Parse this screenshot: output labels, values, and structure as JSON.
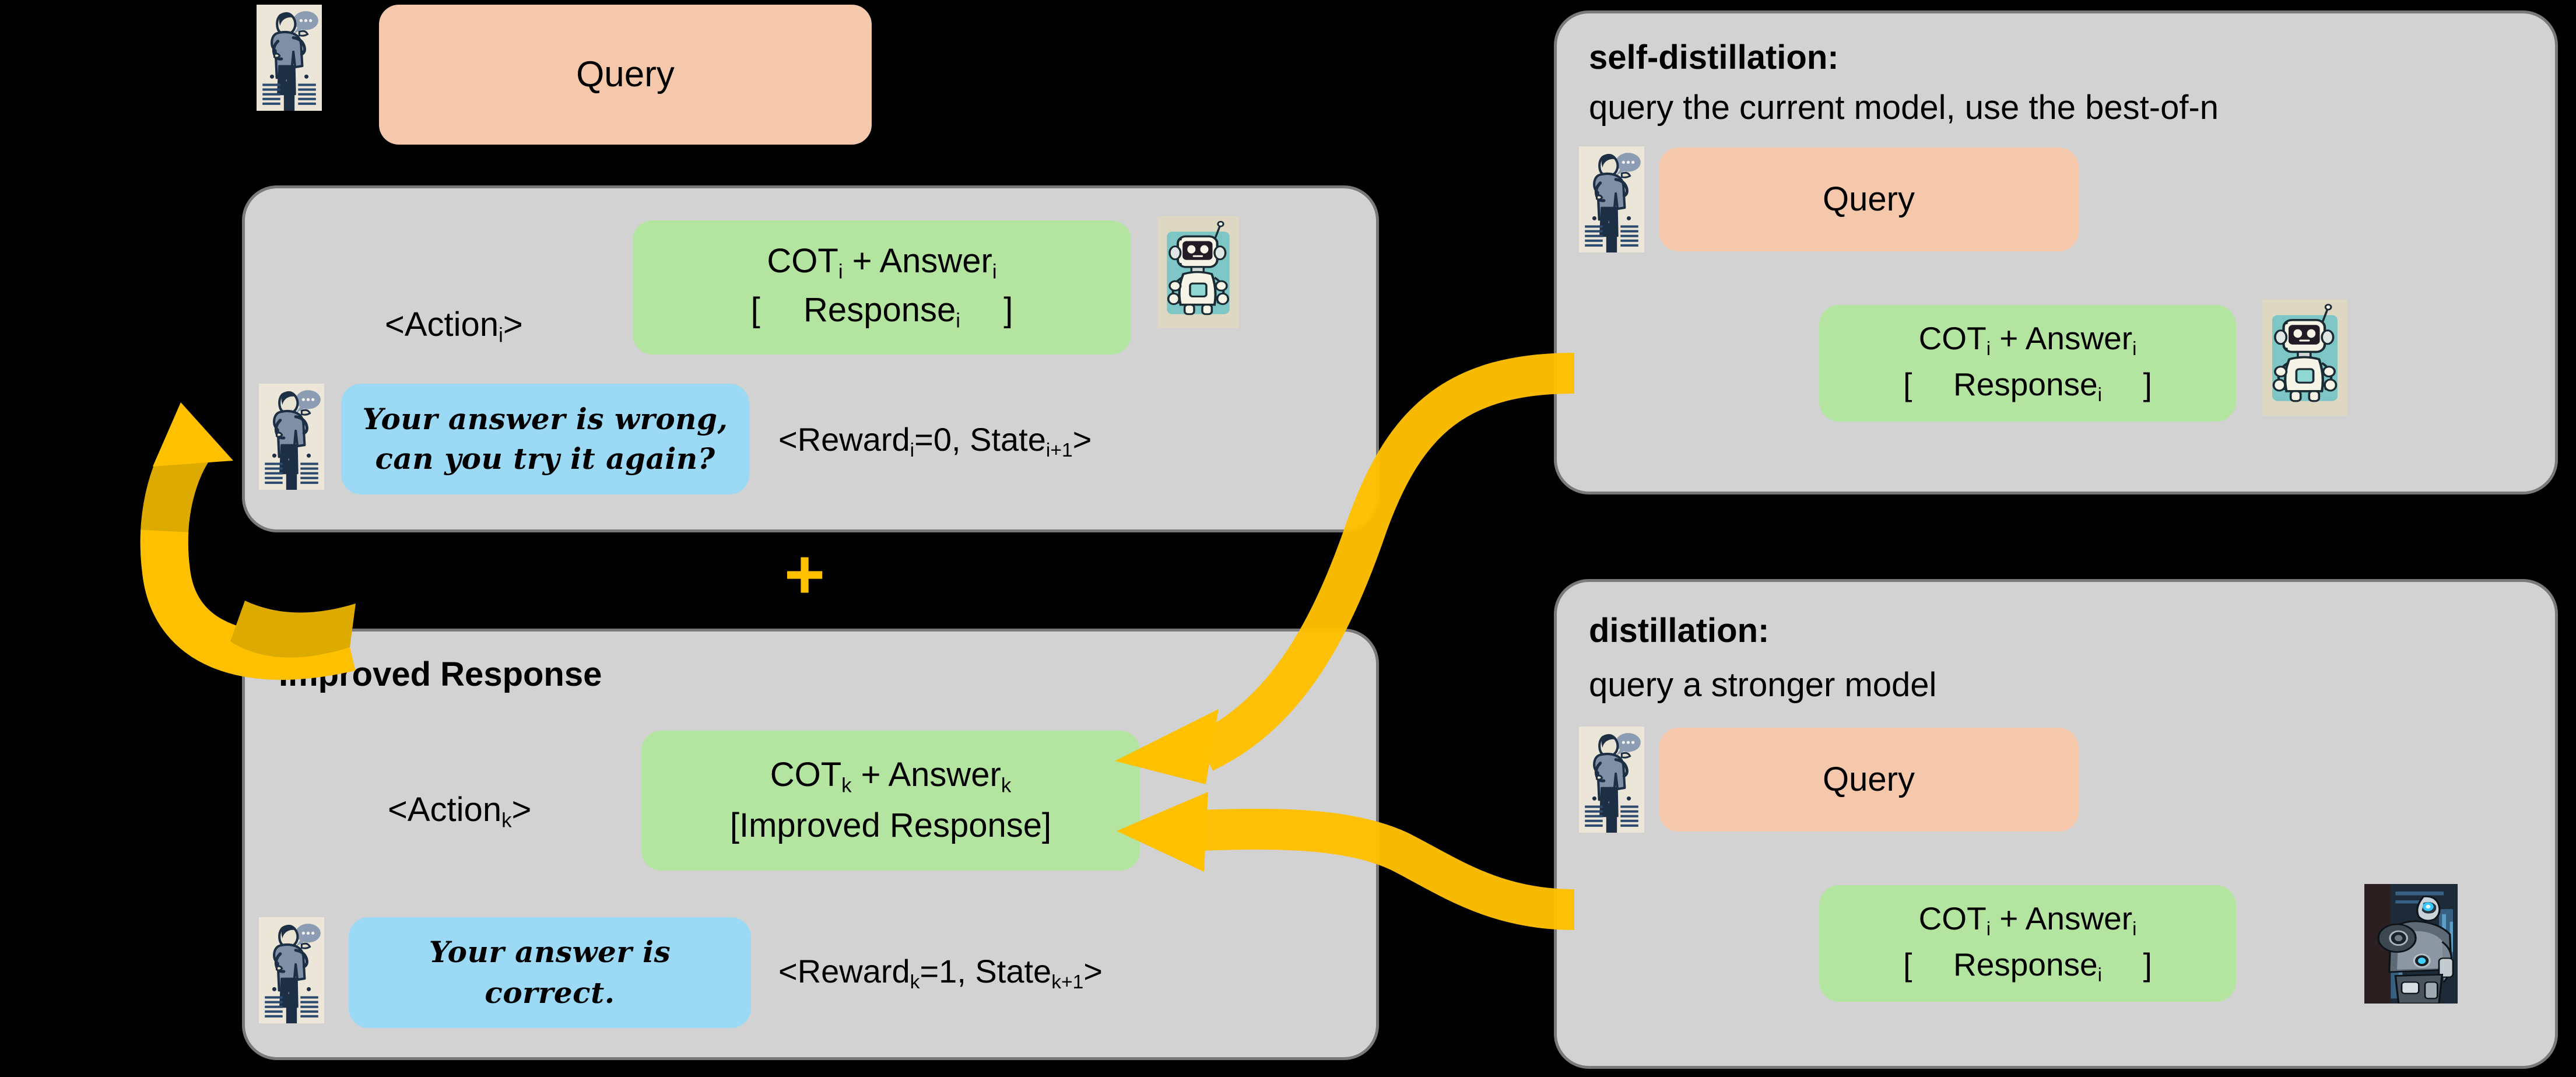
{
  "colors": {
    "panel_bg": "#d2d2d2",
    "panel_border": "#7a7a7a",
    "query_box": "#f5c8ac",
    "response_box": "#b3e5a1",
    "feedback_box": "#9bd9f5",
    "arrow": "#ffc000",
    "background": "#000000"
  },
  "top_query": {
    "label": "Query",
    "avatar": "person-speaking-icon"
  },
  "rollout_panel": {
    "action_label": "<Action",
    "action_sub": "i",
    "action_label_end": ">",
    "response_line1_a": "COT",
    "response_line1_sub_a": "i",
    "response_line1_b": " + Answer",
    "response_line1_sub_b": "i",
    "response_line2_open": "[",
    "response_line2_mid": "Response",
    "response_line2_sub": "i",
    "response_line2_close": "]",
    "robot_avatar": "friendly-robot-icon",
    "person_avatar": "person-speaking-icon",
    "feedback_line1": "Your answer is wrong,",
    "feedback_line2": "can you try it again?",
    "reward_prefix": "<Reward",
    "reward_sub": "i",
    "reward_value": "=0, State",
    "state_sub": "i+1",
    "reward_suffix": ">"
  },
  "plus_symbol": "+",
  "improved_panel": {
    "title": "Improved Response",
    "action_label": "<Action",
    "action_sub": "k",
    "action_label_end": ">",
    "response_line1_a": "COT",
    "response_line1_sub_a": "k",
    "response_line1_b": " + Answer",
    "response_line1_sub_b": "k",
    "response_line2": "[Improved Response]",
    "person_avatar": "person-speaking-icon",
    "feedback_line1": "Your answer is",
    "feedback_line2": "correct.",
    "reward_prefix": "<Reward",
    "reward_sub": "k",
    "reward_value": "=1, State",
    "state_sub": "k+1",
    "reward_suffix": ">"
  },
  "self_distillation_panel": {
    "title": "self-distillation:",
    "subtitle": "query the current model, use the best-of-n",
    "person_avatar": "person-speaking-icon",
    "query_label": "Query",
    "response_line1_a": "COT",
    "response_line1_sub_a": "i",
    "response_line1_b": " + Answer",
    "response_line1_sub_b": "i",
    "response_line2_open": "[",
    "response_line2_mid": "Response",
    "response_line2_sub": "i",
    "response_line2_close": "]",
    "robot_avatar": "friendly-robot-icon"
  },
  "distillation_panel": {
    "title": "distillation:",
    "subtitle": "query a stronger model",
    "person_avatar": "person-speaking-icon",
    "query_label": "Query",
    "response_line1_a": "COT",
    "response_line1_sub_a": "i",
    "response_line1_b": " + Answer",
    "response_line1_sub_b": "i",
    "response_line2_open": "[",
    "response_line2_mid": "Response",
    "response_line2_sub": "i",
    "response_line2_close": "]",
    "robot_avatar": "strong-mech-robot-icon"
  },
  "arrows": {
    "loop_back": "feedback-loop-arrow",
    "self_distill_to_improved": "self-distillation-arrow",
    "distill_to_improved": "distillation-arrow"
  }
}
